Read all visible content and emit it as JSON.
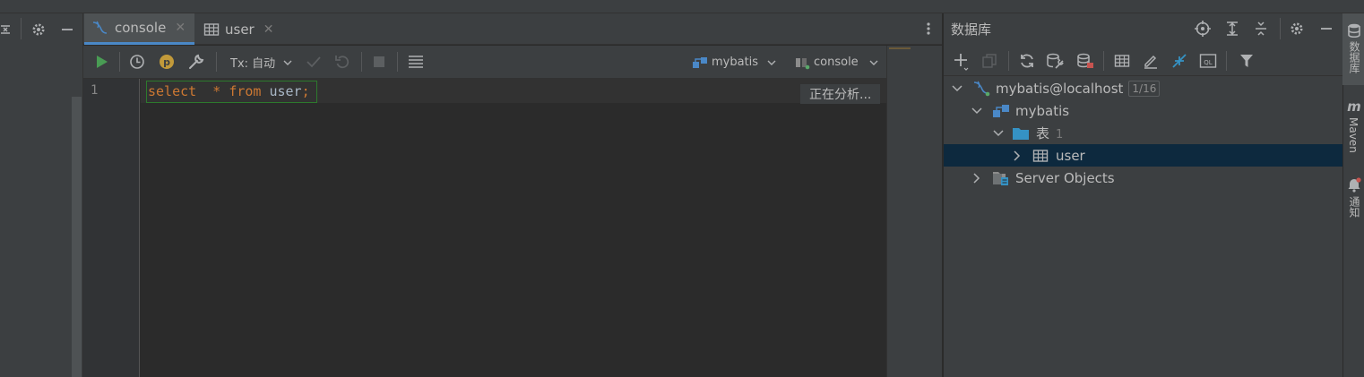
{
  "tabs": [
    {
      "label": "console",
      "icon": "mysql-console-icon",
      "active": true
    },
    {
      "label": "user",
      "icon": "table-icon",
      "active": false
    }
  ],
  "toolbar": {
    "tx_label": "Tx: 自动",
    "datasource_label": "mybatis",
    "session_label": "console"
  },
  "editor": {
    "line_number": "1",
    "code": {
      "kw_select": "select",
      "star": "*",
      "kw_from": "from",
      "table": "user",
      "semicolon": ";"
    },
    "status": "正在分析..."
  },
  "db_panel": {
    "title": "数据库",
    "tree": {
      "connection": {
        "label": "mybatis@localhost",
        "badge": "1/16"
      },
      "schema": {
        "label": "mybatis"
      },
      "tables_folder": {
        "label": "表",
        "count": "1"
      },
      "table": {
        "label": "user"
      },
      "server_objects": {
        "label": "Server Objects"
      }
    }
  },
  "right_strip": {
    "database": "数据库",
    "maven": "Maven",
    "notifications": "通知"
  },
  "colors": {
    "accent": "#4a88c7",
    "run_green": "#499c54",
    "keyword": "#cc7832",
    "selection": "#0d293e"
  }
}
